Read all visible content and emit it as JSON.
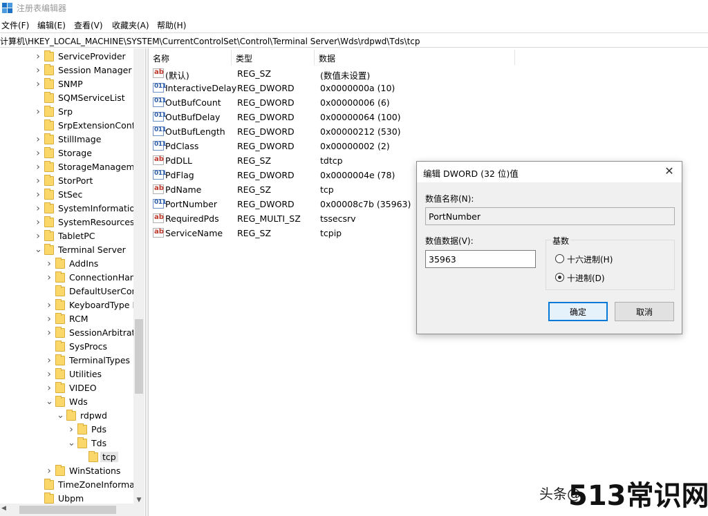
{
  "window": {
    "title": "注册表编辑器"
  },
  "menu": [
    "文件(F)",
    "编辑(E)",
    "查看(V)",
    "收藏夹(A)",
    "帮助(H)"
  ],
  "address": "计算机\\HKEY_LOCAL_MACHINE\\SYSTEM\\CurrentControlSet\\Control\\Terminal Server\\Wds\\rdpwd\\Tds\\tcp",
  "tree": [
    {
      "label": "ServiceProvider",
      "level": 0,
      "expander": "collapsed"
    },
    {
      "label": "Session Manager",
      "level": 0,
      "expander": "collapsed"
    },
    {
      "label": "SNMP",
      "level": 0,
      "expander": "collapsed"
    },
    {
      "label": "SQMServiceList",
      "level": 0,
      "expander": "none"
    },
    {
      "label": "Srp",
      "level": 0,
      "expander": "collapsed"
    },
    {
      "label": "SrpExtensionConfig",
      "level": 0,
      "expander": "none"
    },
    {
      "label": "StillImage",
      "level": 0,
      "expander": "collapsed"
    },
    {
      "label": "Storage",
      "level": 0,
      "expander": "collapsed"
    },
    {
      "label": "StorageManagement",
      "level": 0,
      "expander": "collapsed"
    },
    {
      "label": "StorPort",
      "level": 0,
      "expander": "collapsed"
    },
    {
      "label": "StSec",
      "level": 0,
      "expander": "collapsed"
    },
    {
      "label": "SystemInformation",
      "level": 0,
      "expander": "collapsed"
    },
    {
      "label": "SystemResources",
      "level": 0,
      "expander": "collapsed"
    },
    {
      "label": "TabletPC",
      "level": 0,
      "expander": "collapsed"
    },
    {
      "label": "Terminal Server",
      "level": 0,
      "expander": "expanded"
    },
    {
      "label": "AddIns",
      "level": 1,
      "expander": "collapsed"
    },
    {
      "label": "ConnectionHandler",
      "level": 1,
      "expander": "collapsed"
    },
    {
      "label": "DefaultUserConfiguration",
      "level": 1,
      "expander": "none"
    },
    {
      "label": "KeyboardType Mapping",
      "level": 1,
      "expander": "collapsed"
    },
    {
      "label": "RCM",
      "level": 1,
      "expander": "collapsed"
    },
    {
      "label": "SessionArbitrationHelper",
      "level": 1,
      "expander": "collapsed"
    },
    {
      "label": "SysProcs",
      "level": 1,
      "expander": "none"
    },
    {
      "label": "TerminalTypes",
      "level": 1,
      "expander": "collapsed"
    },
    {
      "label": "Utilities",
      "level": 1,
      "expander": "collapsed"
    },
    {
      "label": "VIDEO",
      "level": 1,
      "expander": "collapsed"
    },
    {
      "label": "Wds",
      "level": 1,
      "expander": "expanded"
    },
    {
      "label": "rdpwd",
      "level": 2,
      "expander": "expanded"
    },
    {
      "label": "Pds",
      "level": 3,
      "expander": "collapsed"
    },
    {
      "label": "Tds",
      "level": 3,
      "expander": "expanded"
    },
    {
      "label": "tcp",
      "level": 4,
      "expander": "none",
      "selected": true
    },
    {
      "label": "WinStations",
      "level": 1,
      "expander": "collapsed"
    },
    {
      "label": "TimeZoneInformation",
      "level": 0,
      "expander": "none"
    },
    {
      "label": "Ubpm",
      "level": 0,
      "expander": "none"
    }
  ],
  "columns": [
    "名称",
    "类型",
    "数据"
  ],
  "values": [
    {
      "icon": "string-value-icon",
      "badge": "ab",
      "name": "(默认)",
      "type": "REG_SZ",
      "data": "(数值未设置)"
    },
    {
      "icon": "dword-value-icon",
      "badge": "011",
      "name": "InteractiveDelay",
      "type": "REG_DWORD",
      "data": "0x0000000a (10)"
    },
    {
      "icon": "dword-value-icon",
      "badge": "011",
      "name": "OutBufCount",
      "type": "REG_DWORD",
      "data": "0x00000006 (6)"
    },
    {
      "icon": "dword-value-icon",
      "badge": "011",
      "name": "OutBufDelay",
      "type": "REG_DWORD",
      "data": "0x00000064 (100)"
    },
    {
      "icon": "dword-value-icon",
      "badge": "011",
      "name": "OutBufLength",
      "type": "REG_DWORD",
      "data": "0x00000212 (530)"
    },
    {
      "icon": "dword-value-icon",
      "badge": "011",
      "name": "PdClass",
      "type": "REG_DWORD",
      "data": "0x00000002 (2)"
    },
    {
      "icon": "string-value-icon",
      "badge": "ab",
      "name": "PdDLL",
      "type": "REG_SZ",
      "data": "tdtcp"
    },
    {
      "icon": "dword-value-icon",
      "badge": "011",
      "name": "PdFlag",
      "type": "REG_DWORD",
      "data": "0x0000004e (78)"
    },
    {
      "icon": "string-value-icon",
      "badge": "ab",
      "name": "PdName",
      "type": "REG_SZ",
      "data": "tcp"
    },
    {
      "icon": "dword-value-icon",
      "badge": "011",
      "name": "PortNumber",
      "type": "REG_DWORD",
      "data": "0x00008c7b (35963)"
    },
    {
      "icon": "string-value-icon",
      "badge": "ab",
      "name": "RequiredPds",
      "type": "REG_MULTI_SZ",
      "data": "tssecsrv"
    },
    {
      "icon": "string-value-icon",
      "badge": "ab",
      "name": "ServiceName",
      "type": "REG_SZ",
      "data": "tcpip"
    }
  ],
  "dialog": {
    "title": "编辑 DWORD (32 位)值",
    "close_glyph": "✕",
    "name_label": "数值名称(N):",
    "name_value": "PortNumber",
    "data_label": "数值数据(V):",
    "data_value": "35963",
    "radix_label": "基数",
    "radix_hex": "十六进制(H)",
    "radix_dec": "十进制(D)",
    "radix_selected": "decimal",
    "ok": "确定",
    "cancel": "取消"
  },
  "watermark": {
    "small": "头条@",
    "big": "513常识网"
  },
  "colors": {
    "folder": "#fcd86b",
    "accent": "#0078d7",
    "dialog_bg": "#f0f0f0"
  }
}
